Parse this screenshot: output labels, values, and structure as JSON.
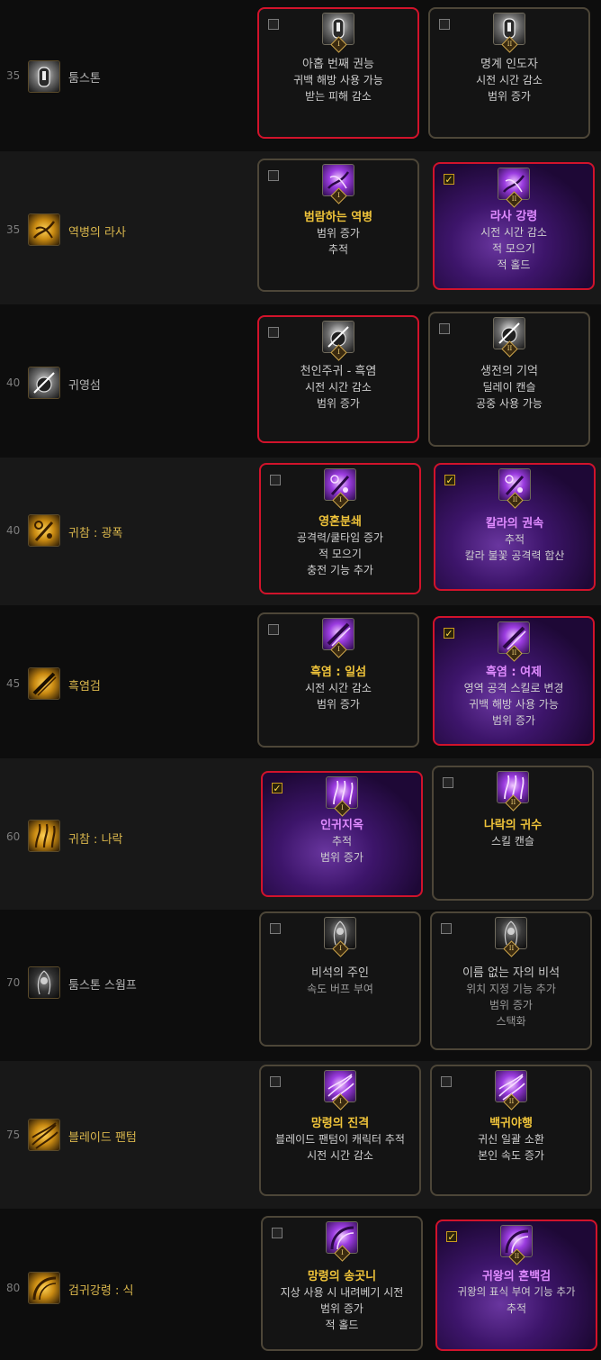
{
  "colors": {
    "background": "#0d0d0d",
    "row_alt": "#181818",
    "card_border": "#4d4638",
    "selected_border": "#d1132b",
    "title_gold": "#f0c43a",
    "title_purple": "#e08bff",
    "skill_name_gold": "#d9b64c",
    "level_gray": "#7d7d7d"
  },
  "skills": [
    {
      "level": "35",
      "name": "툼스톤",
      "icon": "tombstone-icon",
      "talents": [
        {
          "selected": false,
          "title": "아홉 번째 권능",
          "lines": [
            "귀백 해방 사용 가능",
            "받는 피해 감소"
          ],
          "icon": "tombstone-talent-icon",
          "numeral": "I"
        },
        {
          "selected": false,
          "title": "명계 인도자",
          "lines": [
            "시전 시간 감소",
            "범위 증가"
          ],
          "icon": "tombstone-talent-icon",
          "numeral": "II"
        }
      ]
    },
    {
      "level": "35",
      "name": "역병의 라사",
      "icon": "plague-rasa-icon",
      "talents": [
        {
          "selected": false,
          "title": "범람하는 역병",
          "lines": [
            "범위 증가",
            "추적"
          ],
          "icon": "plague-talent-icon",
          "numeral": "I"
        },
        {
          "selected": true,
          "title": "라사 강령",
          "lines": [
            "시전 시간 감소",
            "적 모으기",
            "적 홀드"
          ],
          "icon": "plague-talent-icon",
          "numeral": "II"
        }
      ]
    },
    {
      "level": "40",
      "name": "귀영섬",
      "icon": "ghost-flash-icon",
      "talents": [
        {
          "selected": false,
          "title": "천인주귀 - 흑염",
          "lines": [
            "시전 시간 감소",
            "범위 증가"
          ],
          "icon": "ghost-flash-talent-icon",
          "numeral": "I"
        },
        {
          "selected": false,
          "title": "생전의 기억",
          "lines": [
            "딜레이 캔슬",
            "공중 사용 가능"
          ],
          "icon": "ghost-flash-talent-icon",
          "numeral": "II"
        }
      ]
    },
    {
      "level": "40",
      "name": "귀참 : 광폭",
      "icon": "berserk-slash-icon",
      "talents": [
        {
          "selected": false,
          "title": "영혼분쇄",
          "lines": [
            "공격력/쿨타임 증가",
            "적 모으기",
            "충전 기능 추가"
          ],
          "icon": "berserk-talent-icon",
          "numeral": "I"
        },
        {
          "selected": true,
          "title": "칼라의 권속",
          "lines": [
            "추적",
            "칼라 불꽃 공격력 합산"
          ],
          "icon": "berserk-talent-icon",
          "numeral": "II"
        }
      ]
    },
    {
      "level": "45",
      "name": "흑염검",
      "icon": "black-flame-sword-icon",
      "talents": [
        {
          "selected": false,
          "title": "흑염 : 일섬",
          "lines": [
            "시전 시간 감소",
            "범위 증가"
          ],
          "icon": "black-flame-talent-icon",
          "numeral": "I"
        },
        {
          "selected": true,
          "title": "흑염 : 여제",
          "lines": [
            "영역 공격 스킬로 변경",
            "귀백 해방 사용 가능",
            "범위 증가"
          ],
          "icon": "black-flame-talent-icon",
          "numeral": "II"
        }
      ]
    },
    {
      "level": "60",
      "name": "귀참 : 나락",
      "icon": "abyss-slash-icon",
      "talents": [
        {
          "selected": true,
          "title": "인귀지옥",
          "lines": [
            "추적",
            "범위 증가"
          ],
          "icon": "abyss-talent-icon",
          "numeral": "I"
        },
        {
          "selected": false,
          "title": "나락의 귀수",
          "lines": [
            "스킬 캔슬"
          ],
          "icon": "abyss-talent-icon",
          "numeral": "II"
        }
      ]
    },
    {
      "level": "70",
      "name": "툼스톤 스웜프",
      "icon": "tombstone-swamp-icon",
      "talents": [
        {
          "selected": false,
          "title": "비석의 주인",
          "lines": [
            "속도 버프 부여"
          ],
          "icon": "swamp-talent-icon",
          "numeral": "I"
        },
        {
          "selected": false,
          "title": "이름 없는 자의 비석",
          "lines": [
            "위치 지정 기능 추가",
            "범위 증가",
            "스택화"
          ],
          "icon": "swamp-talent-icon",
          "numeral": "II"
        }
      ]
    },
    {
      "level": "75",
      "name": "블레이드 팬텀",
      "icon": "blade-phantom-icon",
      "talents": [
        {
          "selected": false,
          "title": "망령의 진격",
          "lines": [
            "블레이드 팬텀이 캐릭터 추적",
            "시전 시간 감소"
          ],
          "icon": "phantom-talent-icon",
          "numeral": "I"
        },
        {
          "selected": false,
          "title": "백귀야행",
          "lines": [
            "귀신 일괄 소환",
            "본인 속도 증가"
          ],
          "icon": "phantom-talent-icon",
          "numeral": "II"
        }
      ]
    },
    {
      "level": "80",
      "name": "검귀강령 : 식",
      "icon": "sword-ghost-icon",
      "talents": [
        {
          "selected": false,
          "title": "망령의 송곳니",
          "lines": [
            "지상 사용 시 내려베기 시전",
            "범위 증가",
            "적 홀드"
          ],
          "icon": "sword-ghost-talent-icon",
          "numeral": "I"
        },
        {
          "selected": true,
          "title": "귀왕의 혼백검",
          "lines": [
            "귀왕의 표식 부여 기능 추가",
            "추적"
          ],
          "icon": "sword-ghost-talent-icon",
          "numeral": "II"
        }
      ]
    }
  ]
}
